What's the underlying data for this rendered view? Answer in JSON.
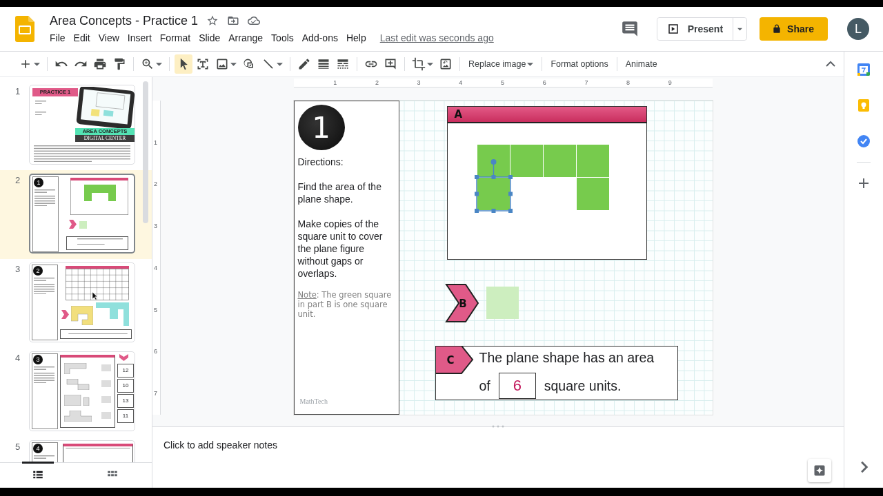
{
  "window": {
    "title": "Area Concepts - Practice 1",
    "last_edit": "Last edit was seconds ago"
  },
  "menu": [
    "File",
    "Edit",
    "View",
    "Insert",
    "Format",
    "Slide",
    "Arrange",
    "Tools",
    "Add-ons",
    "Help"
  ],
  "actions": {
    "present": "Present",
    "share": "Share",
    "avatar": "L"
  },
  "toolbar": {
    "groups": [
      [
        {
          "kind": "new",
          "selected": false,
          "menu": true
        }
      ],
      [
        {
          "kind": "undo",
          "selected": false,
          "menu": false
        },
        {
          "kind": "redo",
          "selected": false,
          "menu": false
        },
        {
          "kind": "print",
          "selected": false,
          "menu": false
        },
        {
          "kind": "paint",
          "selected": false,
          "menu": false
        }
      ],
      [
        {
          "kind": "zoom",
          "selected": false,
          "menu": true
        }
      ],
      [
        {
          "kind": "select",
          "selected": true,
          "menu": false
        },
        {
          "kind": "textbox",
          "selected": false,
          "menu": false
        },
        {
          "kind": "image",
          "selected": false,
          "menu": true
        },
        {
          "kind": "shape",
          "selected": false,
          "menu": false
        },
        {
          "kind": "line",
          "selected": false,
          "menu": true
        }
      ],
      [
        {
          "kind": "pen",
          "selected": false,
          "menu": false
        },
        {
          "kind": "weight",
          "selected": false,
          "menu": false
        },
        {
          "kind": "dash",
          "selected": false,
          "menu": false
        }
      ],
      [
        {
          "kind": "link",
          "selected": false,
          "menu": false
        },
        {
          "kind": "comment",
          "selected": false,
          "menu": false
        }
      ],
      [
        {
          "kind": "crop",
          "selected": false,
          "menu": true
        },
        {
          "kind": "reset",
          "selected": false,
          "menu": false
        }
      ]
    ],
    "buttons": [
      {
        "label": "Replace image",
        "menu": true
      },
      {
        "label": "Format options",
        "menu": false
      },
      {
        "label": "Animate",
        "menu": false
      }
    ]
  },
  "rulers": {
    "horizontal": [
      "1",
      "2",
      "3",
      "4",
      "5",
      "6",
      "7",
      "8",
      "9"
    ],
    "vertical": [
      "1",
      "2",
      "3",
      "4",
      "5",
      "6",
      "7"
    ]
  },
  "filmstrip": [
    {
      "number": "1",
      "selected": false,
      "kind": "title",
      "banner": "PRACTICE 1",
      "brand_1": "AREA CONCEPTS",
      "brand_2": "DIGITAL CENTER"
    },
    {
      "number": "2",
      "selected": true,
      "kind": "area",
      "badge": "1"
    },
    {
      "number": "3",
      "selected": false,
      "kind": "graph",
      "badge": "2"
    },
    {
      "number": "4",
      "selected": false,
      "kind": "table",
      "badge": "3",
      "cards": [
        "12",
        "10",
        "13",
        "11"
      ]
    },
    {
      "number": "5",
      "selected": false,
      "kind": "sort",
      "badge": "4"
    }
  ],
  "slide": {
    "badge": "1",
    "heading": "Directions:",
    "paragraphs": [
      "Find the area of the plane shape.",
      "Make copies of the square unit to cover the plane figure without gaps or overlaps."
    ],
    "note": {
      "label": "Note",
      "text": ": The green square in part B is one square unit."
    },
    "logo": "MathTech",
    "part_a": {
      "label": "A",
      "grid": [
        [
          {
            "filled": true,
            "selected": false
          },
          {
            "filled": true,
            "selected": false
          },
          {
            "filled": true,
            "selected": false
          },
          {
            "filled": true,
            "selected": false
          }
        ],
        [
          {
            "filled": true,
            "selected": true
          },
          {
            "filled": false,
            "selected": false
          },
          {
            "filled": false,
            "selected": false
          },
          {
            "filled": true,
            "selected": false
          }
        ]
      ]
    },
    "part_b": {
      "label": "B"
    },
    "part_c": {
      "label": "C",
      "line_1": "The plane shape has an area",
      "before": "of",
      "answer": "6",
      "after": "square units."
    }
  },
  "speaker_notes": {
    "placeholder": "Click to add speaker notes"
  }
}
